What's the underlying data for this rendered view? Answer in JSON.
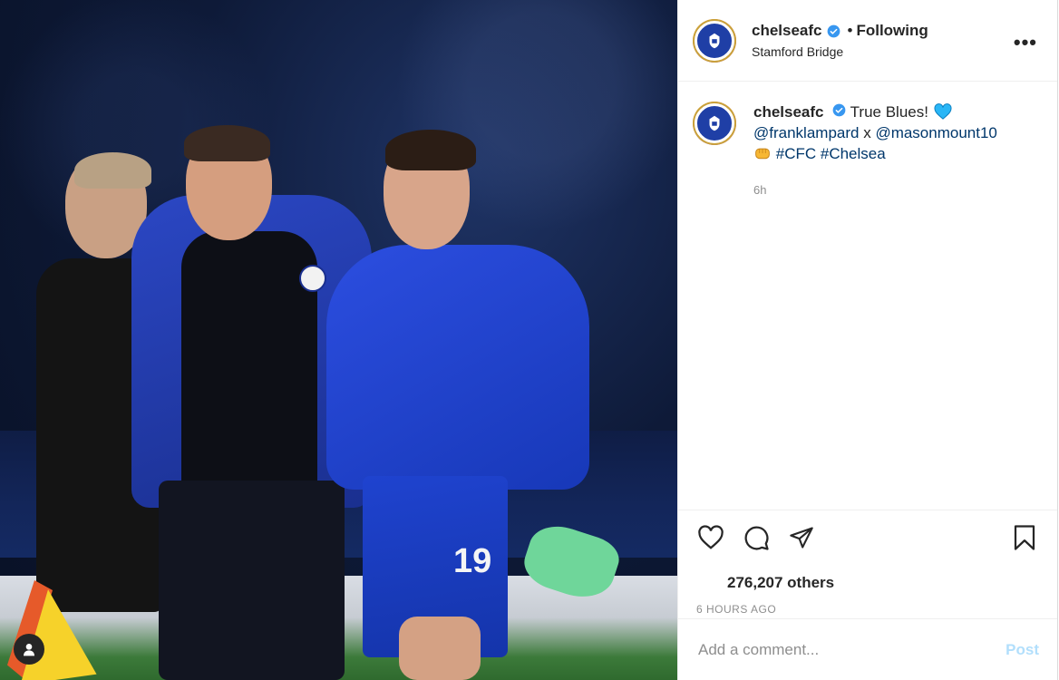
{
  "post": {
    "photo": {
      "shirt_number": "19"
    },
    "header": {
      "username": "chelseafc",
      "separator": "•",
      "follow_status": "Following",
      "location": "Stamford Bridge",
      "more_label": "•••"
    },
    "caption": {
      "username": "chelseafc",
      "text": "True Blues!",
      "mention1": "@franklampard",
      "connector": "x",
      "mention2": "@masonmount10",
      "hashtag1": "#CFC",
      "hashtag2": "#Chelsea",
      "time": "6h"
    },
    "actions": {
      "icons": [
        "heart-icon",
        "comment-icon",
        "share-icon",
        "bookmark-icon"
      ]
    },
    "likes_text": "276,207 others",
    "posted_ago": "6 HOURS AGO",
    "comment": {
      "placeholder": "Add a comment...",
      "post_label": "Post"
    },
    "colors": {
      "chelsea_blue": "#1f3fa6",
      "verified_blue": "#3897f0",
      "link": "#00376b",
      "post_button_disabled": "#b2dffc"
    }
  }
}
